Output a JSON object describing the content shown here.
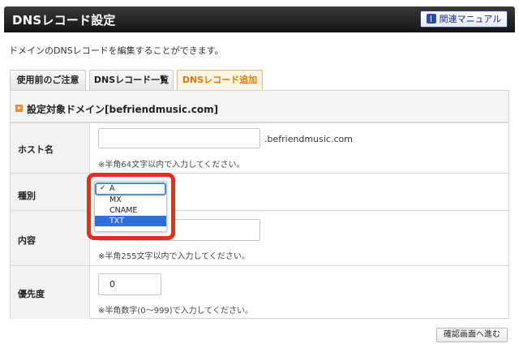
{
  "header": {
    "title": "DNSレコード設定",
    "manual_button": "関連マニュアル"
  },
  "description": "ドメインのDNSレコードを編集することができます。",
  "tabs": [
    {
      "label": "使用前のご注意",
      "active": false
    },
    {
      "label": "DNSレコード一覧",
      "active": false
    },
    {
      "label": "DNSレコード追加",
      "active": true
    }
  ],
  "panel": {
    "title": "設定対象ドメイン[befriendmusic.com]"
  },
  "form": {
    "host": {
      "label": "ホスト名",
      "value": "",
      "suffix": ".befriendmusic.com",
      "note": "※半角64文字以内で入力してください。"
    },
    "type": {
      "label": "種別",
      "options": [
        "A",
        "MX",
        "CNAME",
        "TXT"
      ],
      "checked": "A",
      "highlighted": "TXT"
    },
    "content": {
      "label": "内容",
      "value": "",
      "note": "※半角255文字以内で入力してください。"
    },
    "priority": {
      "label": "優先度",
      "value": "0",
      "note": "※半角数字(0〜999)で入力してください。"
    }
  },
  "next_button": "確認画面へ進む",
  "colors": {
    "header_bg": "#1e1e1e",
    "active_tab_text": "#e07800",
    "highlight_ring": "#ea2b20",
    "selected_option": "#2d6fd6"
  }
}
